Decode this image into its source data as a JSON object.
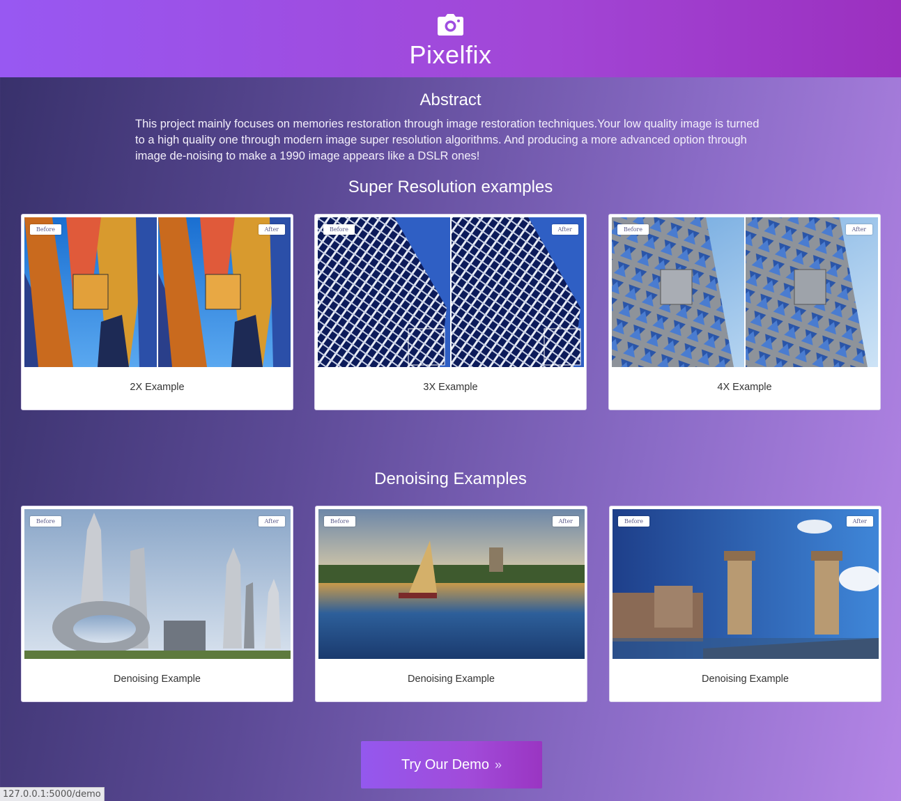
{
  "header": {
    "brand": "Pixelfix",
    "logo_icon": "camera-icon"
  },
  "abstract": {
    "title": "Abstract",
    "text": "This project mainly focuses on memories restoration through image restoration techniques.Your low quality image is turned to a high quality one through modern image super resolution algorithms. And producing a more advanced option through image de-noising to make a 1990 image appears like a DSLR ones!"
  },
  "super_resolution": {
    "title": "Super Resolution examples",
    "cards": [
      {
        "before": "Before",
        "after": "After",
        "caption": "2X Example"
      },
      {
        "before": "Before",
        "after": "After",
        "caption": "3X Example"
      },
      {
        "before": "Before",
        "after": "After",
        "caption": "4X Example"
      }
    ]
  },
  "denoising": {
    "title": "Denoising Examples",
    "cards": [
      {
        "before": "Before",
        "after": "After",
        "caption": "Denoising Example"
      },
      {
        "before": "Before",
        "after": "After",
        "caption": "Denoising Example"
      },
      {
        "before": "Before",
        "after": "After",
        "caption": "Denoising Example"
      }
    ]
  },
  "cta": {
    "label": "Try Our Demo",
    "chevron": "»"
  },
  "status_bar": {
    "url": "127.0.0.1:5000/demo"
  },
  "colors": {
    "header_start": "#9858f2",
    "header_end": "#9b30bf",
    "background_start": "#37306a",
    "background_end": "#b485e6"
  }
}
